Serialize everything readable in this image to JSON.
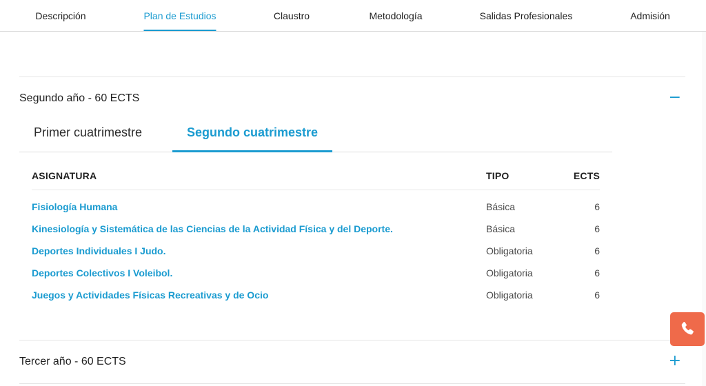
{
  "nav": {
    "items": [
      {
        "label": "Descripción"
      },
      {
        "label": "Plan de Estudios"
      },
      {
        "label": "Claustro"
      },
      {
        "label": "Metodología"
      },
      {
        "label": "Salidas Profesionales"
      },
      {
        "label": "Admisión"
      }
    ],
    "active_index": 1
  },
  "accordion": {
    "second_year": {
      "title": "Segundo año - 60 ECTS",
      "toggle": "−"
    },
    "third_year": {
      "title": "Tercer año - 60 ECTS",
      "toggle": "+"
    }
  },
  "subtabs": {
    "items": [
      {
        "label": "Primer cuatrimestre"
      },
      {
        "label": "Segundo cuatrimestre"
      }
    ],
    "active_index": 1
  },
  "table": {
    "headers": {
      "name": "ASIGNATURA",
      "type": "TIPO",
      "ects": "ECTS"
    },
    "rows": [
      {
        "name": "Fisiología Humana",
        "type": "Básica",
        "ects": "6"
      },
      {
        "name": "Kinesiología y Sistemática de las Ciencias de la Actividad Física y del Deporte.",
        "type": "Básica",
        "ects": "6"
      },
      {
        "name": "Deportes Individuales I Judo.",
        "type": "Obligatoria",
        "ects": "6"
      },
      {
        "name": "Deportes Colectivos I Voleibol.",
        "type": "Obligatoria",
        "ects": "6"
      },
      {
        "name": "Juegos y Actividades Físicas Recreativas y de Ocio",
        "type": "Obligatoria",
        "ects": "6"
      }
    ]
  },
  "colors": {
    "accent": "#1a9bd0",
    "call_button": "#ef6a4a"
  },
  "icons": {
    "call": "phone-icon"
  }
}
